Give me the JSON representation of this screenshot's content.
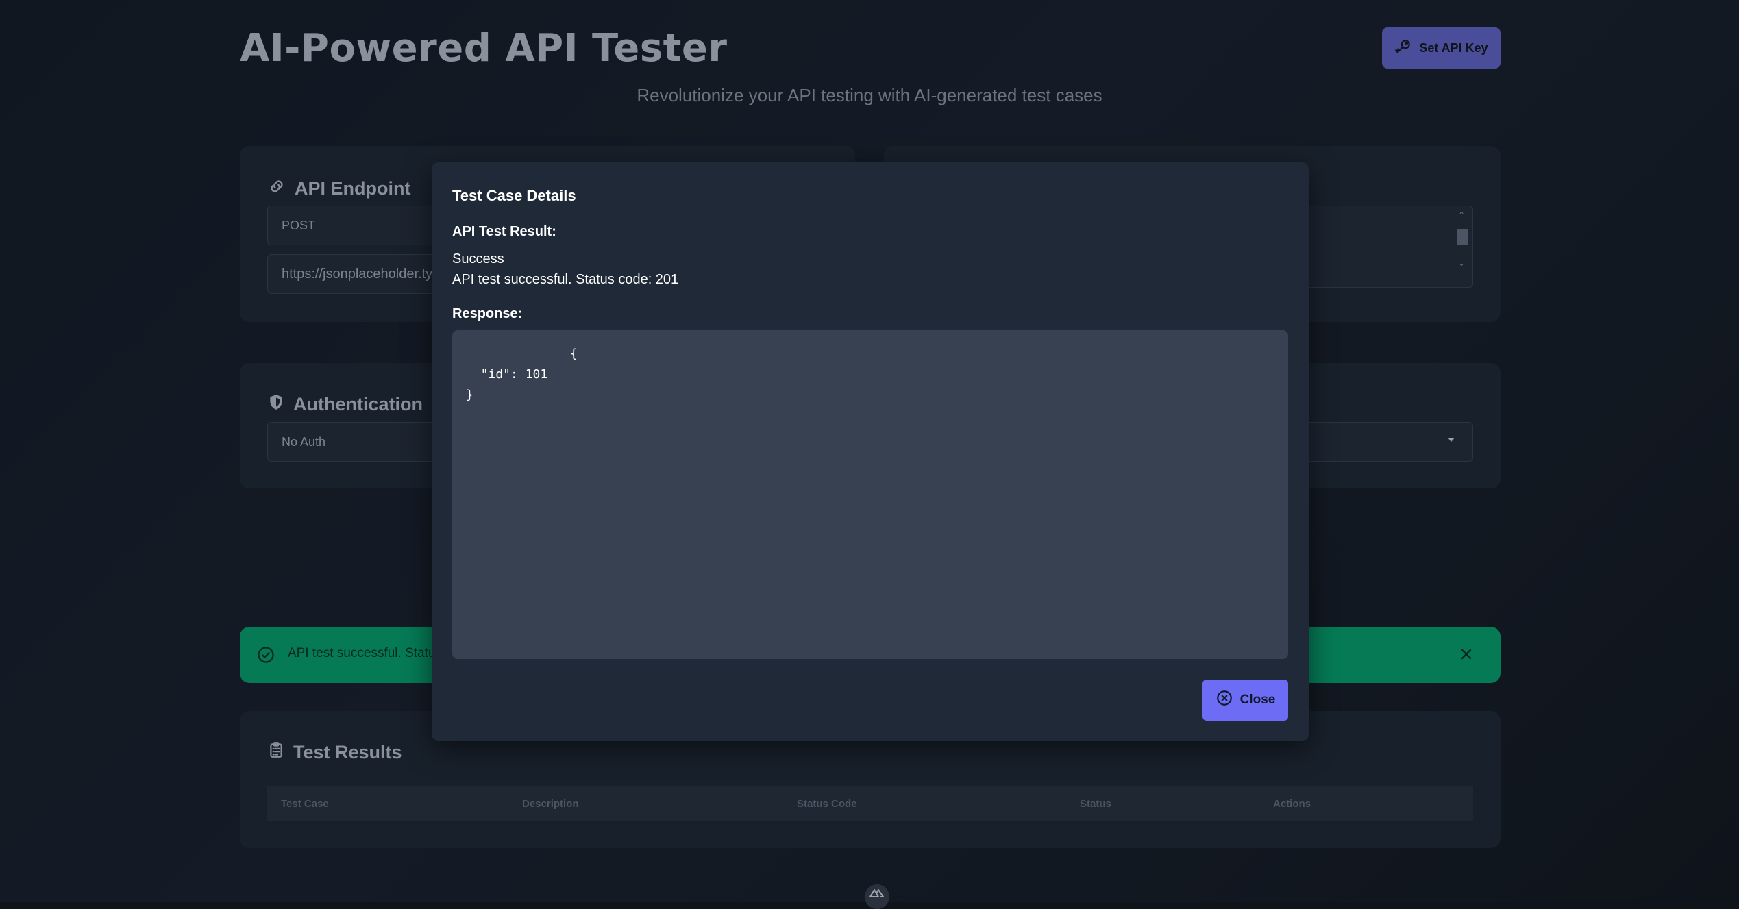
{
  "header": {
    "title": "AI-Powered API Tester",
    "subtitle": "Revolutionize your API testing with AI-generated test cases",
    "api_key_button": "Set API Key",
    "api_key_icon": "key-icon"
  },
  "endpoint_card": {
    "title": "API Endpoint",
    "icon": "link-icon",
    "method": "POST",
    "url": "https://jsonplaceholder.ty"
  },
  "auth_card": {
    "title": "Authentication",
    "icon": "shield-icon",
    "selected": "No Auth"
  },
  "toast": {
    "message": "API test successful. Statu",
    "icon": "check-circle-icon",
    "close_icon": "close-icon"
  },
  "results": {
    "title": "Test Results",
    "icon": "clipboard-icon",
    "columns": [
      "Test Case",
      "Description",
      "Status Code",
      "Status",
      "Actions"
    ]
  },
  "modal": {
    "title": "Test Case Details",
    "result_label": "API Test Result:",
    "status": "Success",
    "message": "API test successful. Status code: 201",
    "response_label": "Response:",
    "response_body": "              {\n  \"id\": 101\n}",
    "close_button": "Close",
    "close_icon": "x-circle-icon"
  },
  "colors": {
    "background": "#111721",
    "accent": "#6c6cf5",
    "success": "#057a55",
    "modal": "#1f2937"
  }
}
